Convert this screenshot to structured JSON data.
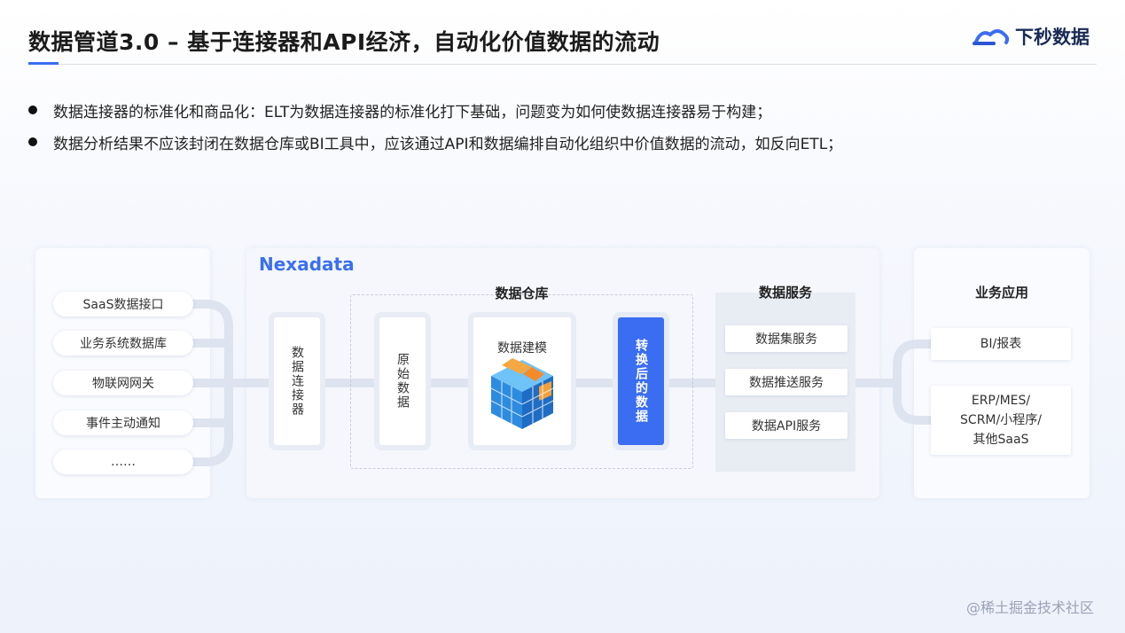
{
  "header": {
    "title": "数据管道3.0 – 基于连接器和API经济，自动化价值数据的流动",
    "logo_text": "下秒数据"
  },
  "bullets": [
    "数据连接器的标准化和商品化：ELT为数据连接器的标准化打下基础，问题变为如何使数据连接器易于构建；",
    "数据分析结果不应该封闭在数据仓库或BI工具中，应该通过API和数据编排自动化组织中价值数据的流动，如反向ETL；"
  ],
  "sources": [
    "SaaS数据接口",
    "业务系统数据库",
    "物联网网关",
    "事件主动通知",
    "……"
  ],
  "nexadata": {
    "label": "Nexadata",
    "connector": "数据连接器",
    "warehouse": {
      "title": "数据仓库",
      "raw": "原始数据",
      "modeling": "数据建模",
      "transformed": "转换后的数据"
    },
    "services": {
      "title": "数据服务",
      "items": [
        "数据集服务",
        "数据推送服务",
        "数据API服务"
      ]
    }
  },
  "apps": {
    "title": "业务应用",
    "items": [
      "BI/报表",
      "ERP/MES/\nSCRM/小程序/\n其他SaaS"
    ]
  },
  "watermark": "@稀土掘金技术社区",
  "colors": {
    "accent": "#3b6df2",
    "flow": "#dde3ef"
  }
}
